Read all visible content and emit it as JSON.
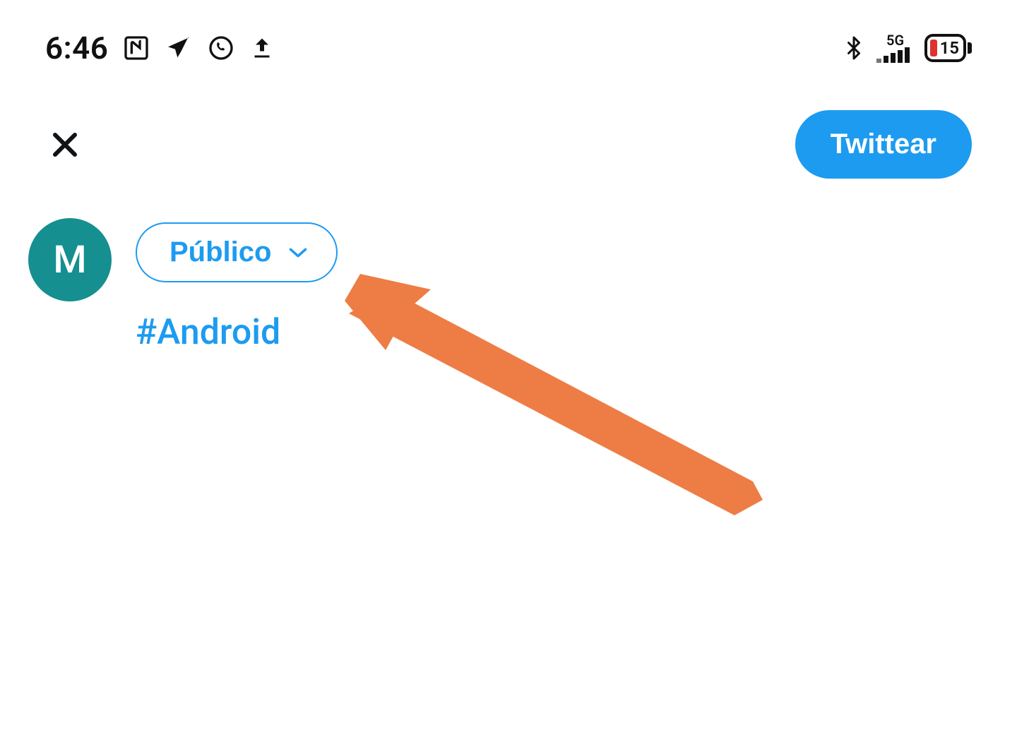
{
  "status_bar": {
    "time": "6:46",
    "network_label": "5G",
    "battery_percent": "15"
  },
  "header": {
    "tweet_button": "Twittear"
  },
  "compose": {
    "avatar_initial": "M",
    "audience_label": "Público",
    "tweet_text": "#Android"
  },
  "colors": {
    "accent": "#1d9bf0",
    "avatar_bg": "#158f8f",
    "annotation": "#ed7d45",
    "battery_low": "#d33"
  }
}
